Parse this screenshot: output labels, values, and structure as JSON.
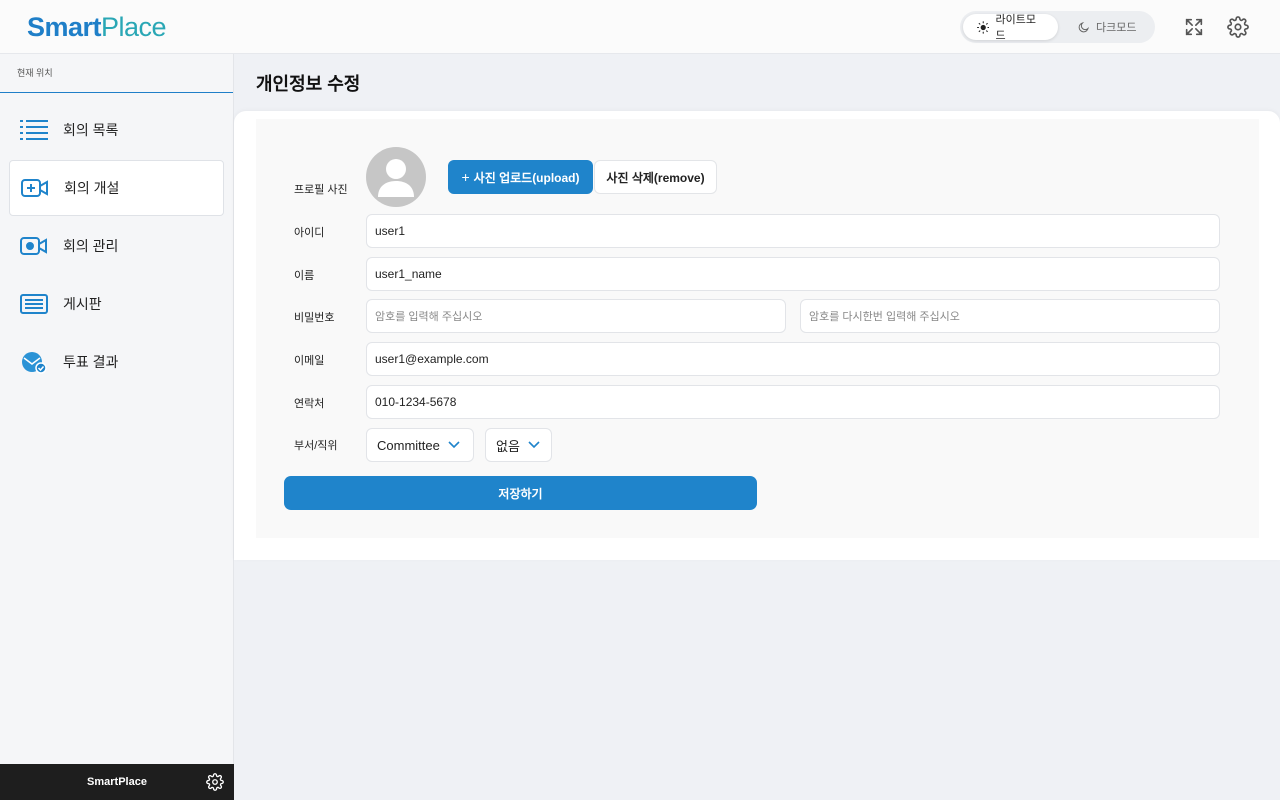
{
  "header": {
    "logo_smart": "Smart",
    "logo_place": "Place",
    "theme_light": "라이트모드",
    "theme_dark": "다크모드"
  },
  "sidebar": {
    "crumb": "현재 위치",
    "items": [
      {
        "label": "회의 목록",
        "icon": "list-icon"
      },
      {
        "label": "회의 개설",
        "icon": "video-add-icon"
      },
      {
        "label": "회의 관리",
        "icon": "video-settings-icon"
      },
      {
        "label": "게시판",
        "icon": "board-icon"
      },
      {
        "label": "투표 결과",
        "icon": "vote-result-icon"
      }
    ],
    "active_index": 1,
    "footer": "SmartPlace"
  },
  "page": {
    "title": "개인정보 수정"
  },
  "form": {
    "photo_label": "프로필 사진",
    "upload_label": "사진 업로드(upload)",
    "upload_icon": "+",
    "remove_label": "사진 삭제(remove)",
    "id_label": "아이디",
    "id_value": "user1",
    "name_label": "이름",
    "name_value": "user1_name",
    "pw_label": "비밀번호",
    "pw_placeholder": "암호를 입력해 주십시오",
    "pw2_placeholder": "암호를 다시한번 입력해 주십시오",
    "email_label": "이메일",
    "email_value": "user1@example.com",
    "phone_label": "연락처",
    "phone_value": "010-1234-5678",
    "dept_label": "부서/직위",
    "dept_value": "Committee",
    "position_value": "없음",
    "save_label": "저장하기"
  },
  "colors": {
    "accent": "#1f84cb",
    "logo_place": "#2aa7b5"
  }
}
